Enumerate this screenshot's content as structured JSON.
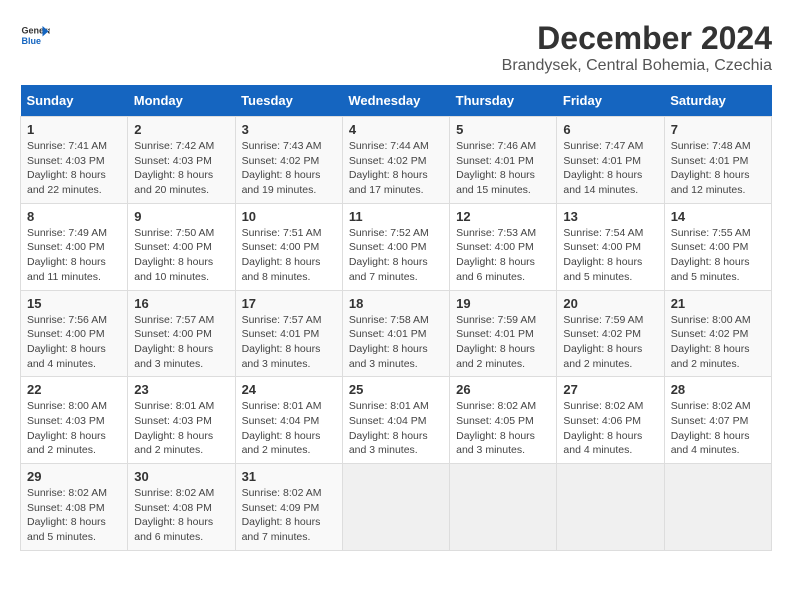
{
  "header": {
    "logo_line1": "General",
    "logo_line2": "Blue",
    "title": "December 2024",
    "location": "Brandysek, Central Bohemia, Czechia"
  },
  "calendar": {
    "days_of_week": [
      "Sunday",
      "Monday",
      "Tuesday",
      "Wednesday",
      "Thursday",
      "Friday",
      "Saturday"
    ],
    "weeks": [
      [
        null,
        {
          "day": 2,
          "sunrise": "7:42 AM",
          "sunset": "4:03 PM",
          "daylight": "8 hours and 20 minutes"
        },
        {
          "day": 3,
          "sunrise": "7:43 AM",
          "sunset": "4:02 PM",
          "daylight": "8 hours and 19 minutes"
        },
        {
          "day": 4,
          "sunrise": "7:44 AM",
          "sunset": "4:02 PM",
          "daylight": "8 hours and 17 minutes"
        },
        {
          "day": 5,
          "sunrise": "7:46 AM",
          "sunset": "4:01 PM",
          "daylight": "8 hours and 15 minutes"
        },
        {
          "day": 6,
          "sunrise": "7:47 AM",
          "sunset": "4:01 PM",
          "daylight": "8 hours and 14 minutes"
        },
        {
          "day": 7,
          "sunrise": "7:48 AM",
          "sunset": "4:01 PM",
          "daylight": "8 hours and 12 minutes"
        }
      ],
      [
        {
          "day": 1,
          "sunrise": "7:41 AM",
          "sunset": "4:03 PM",
          "daylight": "8 hours and 22 minutes"
        },
        {
          "day": 9,
          "sunrise": "7:50 AM",
          "sunset": "4:00 PM",
          "daylight": "8 hours and 10 minutes"
        },
        {
          "day": 10,
          "sunrise": "7:51 AM",
          "sunset": "4:00 PM",
          "daylight": "8 hours and 8 minutes"
        },
        {
          "day": 11,
          "sunrise": "7:52 AM",
          "sunset": "4:00 PM",
          "daylight": "8 hours and 7 minutes"
        },
        {
          "day": 12,
          "sunrise": "7:53 AM",
          "sunset": "4:00 PM",
          "daylight": "8 hours and 6 minutes"
        },
        {
          "day": 13,
          "sunrise": "7:54 AM",
          "sunset": "4:00 PM",
          "daylight": "8 hours and 5 minutes"
        },
        {
          "day": 14,
          "sunrise": "7:55 AM",
          "sunset": "4:00 PM",
          "daylight": "8 hours and 5 minutes"
        }
      ],
      [
        {
          "day": 8,
          "sunrise": "7:49 AM",
          "sunset": "4:00 PM",
          "daylight": "8 hours and 11 minutes"
        },
        {
          "day": 16,
          "sunrise": "7:57 AM",
          "sunset": "4:00 PM",
          "daylight": "8 hours and 3 minutes"
        },
        {
          "day": 17,
          "sunrise": "7:57 AM",
          "sunset": "4:01 PM",
          "daylight": "8 hours and 3 minutes"
        },
        {
          "day": 18,
          "sunrise": "7:58 AM",
          "sunset": "4:01 PM",
          "daylight": "8 hours and 3 minutes"
        },
        {
          "day": 19,
          "sunrise": "7:59 AM",
          "sunset": "4:01 PM",
          "daylight": "8 hours and 2 minutes"
        },
        {
          "day": 20,
          "sunrise": "7:59 AM",
          "sunset": "4:02 PM",
          "daylight": "8 hours and 2 minutes"
        },
        {
          "day": 21,
          "sunrise": "8:00 AM",
          "sunset": "4:02 PM",
          "daylight": "8 hours and 2 minutes"
        }
      ],
      [
        {
          "day": 15,
          "sunrise": "7:56 AM",
          "sunset": "4:00 PM",
          "daylight": "8 hours and 4 minutes"
        },
        {
          "day": 23,
          "sunrise": "8:01 AM",
          "sunset": "4:03 PM",
          "daylight": "8 hours and 2 minutes"
        },
        {
          "day": 24,
          "sunrise": "8:01 AM",
          "sunset": "4:04 PM",
          "daylight": "8 hours and 2 minutes"
        },
        {
          "day": 25,
          "sunrise": "8:01 AM",
          "sunset": "4:04 PM",
          "daylight": "8 hours and 3 minutes"
        },
        {
          "day": 26,
          "sunrise": "8:02 AM",
          "sunset": "4:05 PM",
          "daylight": "8 hours and 3 minutes"
        },
        {
          "day": 27,
          "sunrise": "8:02 AM",
          "sunset": "4:06 PM",
          "daylight": "8 hours and 4 minutes"
        },
        {
          "day": 28,
          "sunrise": "8:02 AM",
          "sunset": "4:07 PM",
          "daylight": "8 hours and 4 minutes"
        }
      ],
      [
        {
          "day": 22,
          "sunrise": "8:00 AM",
          "sunset": "4:03 PM",
          "daylight": "8 hours and 2 minutes"
        },
        {
          "day": 30,
          "sunrise": "8:02 AM",
          "sunset": "4:08 PM",
          "daylight": "8 hours and 6 minutes"
        },
        {
          "day": 31,
          "sunrise": "8:02 AM",
          "sunset": "4:09 PM",
          "daylight": "8 hours and 7 minutes"
        },
        null,
        null,
        null,
        null
      ],
      [
        {
          "day": 29,
          "sunrise": "8:02 AM",
          "sunset": "4:08 PM",
          "daylight": "8 hours and 5 minutes"
        },
        null,
        null,
        null,
        null,
        null,
        null
      ]
    ]
  }
}
